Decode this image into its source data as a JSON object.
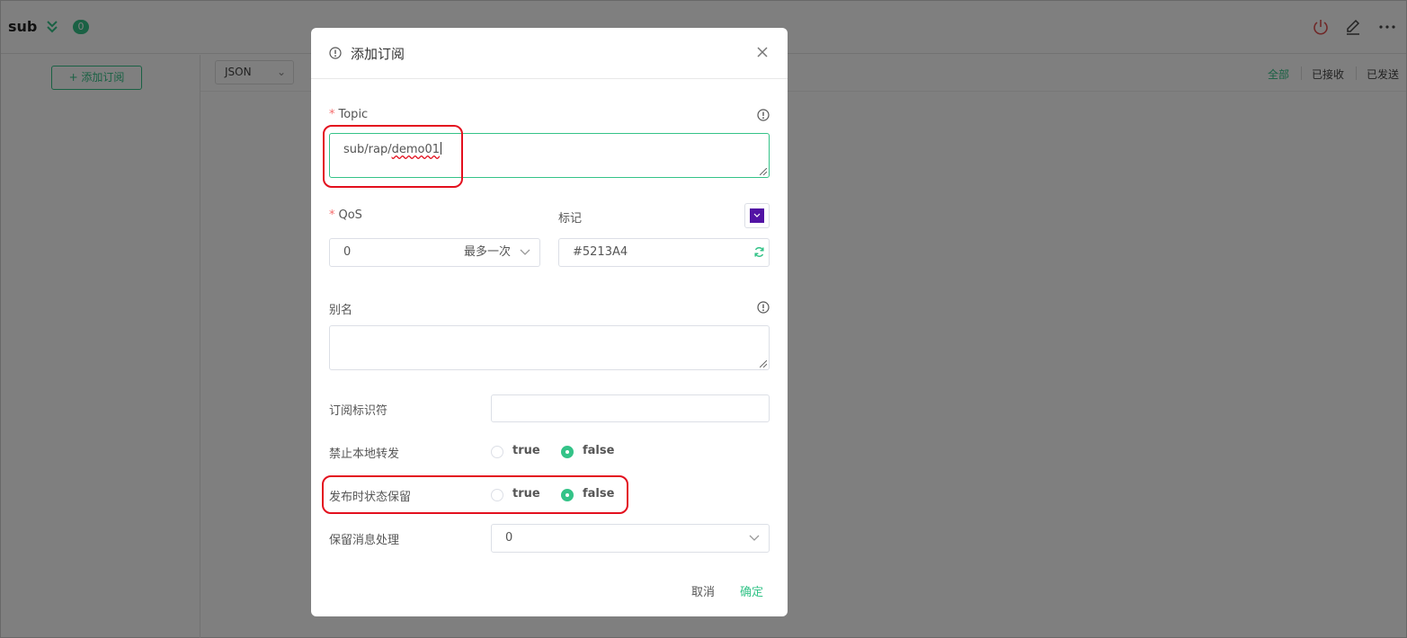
{
  "header": {
    "connection_name": "sub",
    "message_count": "0"
  },
  "sidebar": {
    "add_subscription_label": "+ 添加订阅"
  },
  "message_panel": {
    "format_value": "JSON",
    "filters": [
      "全部",
      "已接收",
      "已发送"
    ],
    "active_filter_color": "#34c388"
  },
  "dialog": {
    "title": "添加订阅",
    "topic_label": "Topic",
    "topic_value": "sub/rap/",
    "topic_value_misspelled": "demo01",
    "qos_label": "QoS",
    "qos_value": "0",
    "qos_value_description": "最多一次",
    "mark_label": "标记",
    "mark_color": "#5213A4",
    "mark_color_text": "#5213A4",
    "alias_label": "别名",
    "alias_value": "",
    "sub_id_label": "订阅标识符",
    "sub_id_value": "",
    "no_local_label": "禁止本地转发",
    "rap_label": "发布时状态保留",
    "retain_handling_label": "保留消息处理",
    "retain_handling_value": "0",
    "option_true": "true",
    "option_false": "false",
    "no_local_selected": "false",
    "rap_selected": "false",
    "cancel_label": "取消",
    "confirm_label": "确定"
  },
  "colors": {
    "accent": "#34c388",
    "required": "#f56c6c",
    "annotation": "#e3101e"
  }
}
